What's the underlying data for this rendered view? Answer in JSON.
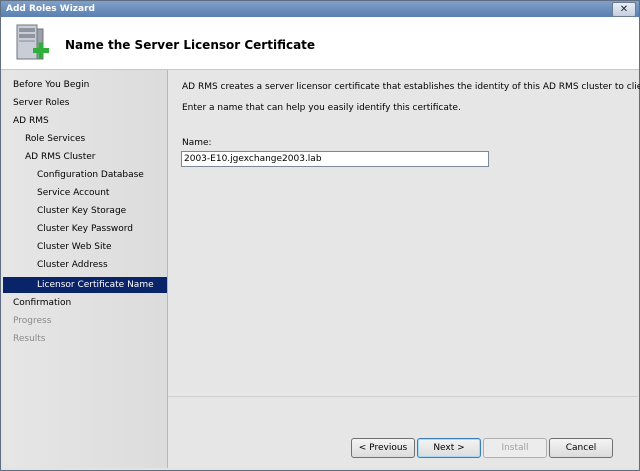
{
  "window": {
    "title": "Add Roles Wizard",
    "close_glyph": "✕"
  },
  "header": {
    "title": "Name the Server Licensor Certificate",
    "icon": "server-add-icon"
  },
  "sidebar": {
    "items": [
      {
        "label": "Before You Begin",
        "state": "normal"
      },
      {
        "label": "Server Roles",
        "state": "normal"
      },
      {
        "label": "AD RMS",
        "state": "normal"
      },
      {
        "label": "Role Services",
        "state": "normal"
      },
      {
        "label": "AD RMS Cluster",
        "state": "normal"
      },
      {
        "label": "Configuration Database",
        "state": "normal"
      },
      {
        "label": "Service Account",
        "state": "normal"
      },
      {
        "label": "Cluster Key Storage",
        "state": "normal"
      },
      {
        "label": "Cluster Key Password",
        "state": "normal"
      },
      {
        "label": "Cluster Web Site",
        "state": "normal"
      },
      {
        "label": "Cluster Address",
        "state": "normal"
      },
      {
        "label": "Licensor Certificate Name",
        "state": "selected"
      },
      {
        "label": "Confirmation",
        "state": "normal"
      },
      {
        "label": "Progress",
        "state": "disabled"
      },
      {
        "label": "Results",
        "state": "disabled"
      }
    ]
  },
  "content": {
    "description": "AD RMS creates a server licensor certificate that establishes the identity of this AD RMS cluster to clients.",
    "instruction": "Enter a name that can help you easily identify this certificate.",
    "name_label": "Name:",
    "name_value": "2003-E10.jgexchange2003.lab"
  },
  "buttons": {
    "previous": "< Previous",
    "next": "Next >",
    "install": "Install",
    "cancel": "Cancel"
  },
  "colors": {
    "selected_bg": "#0a246a",
    "title_bar": "#6a8dbd"
  }
}
